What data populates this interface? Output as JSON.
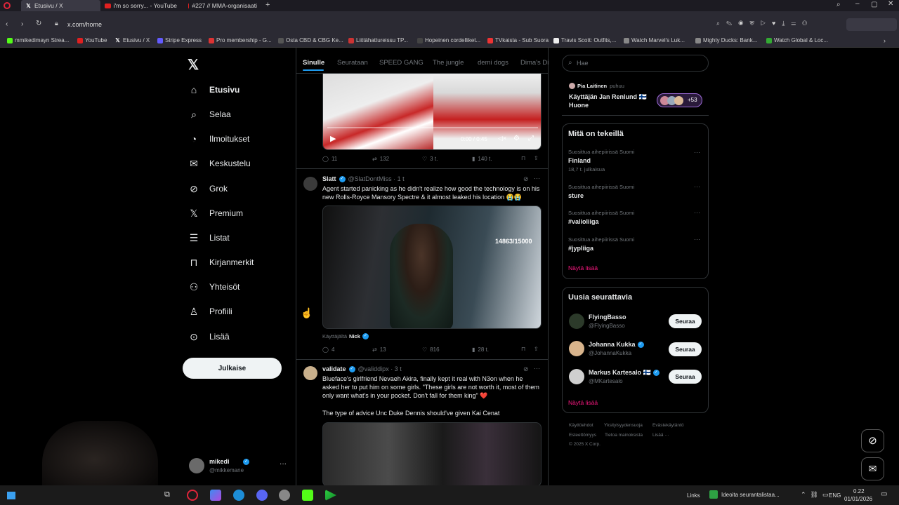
{
  "browser": {
    "tabs": [
      {
        "title": "Etusivu / X",
        "active": true
      },
      {
        "title": "i'm so sorry... - YouTube"
      },
      {
        "title": "#227 // MMA-organisaati"
      }
    ],
    "new_tab": "+",
    "url": "x.com/home",
    "bookmarks": [
      "mmikedimayn Strea...",
      "YouTube",
      "Etusivu / X",
      "Stripe Express",
      "Pro membership - G...",
      "Osta CBD & CBG Ke...",
      "Liittähattureissu TP...",
      "Hopeinen cordelliket...",
      "TVkaista - Sub Suora",
      "Travis Scott: Outfits,...",
      "Watch Marvel's Luk...",
      "Mighty Ducks: Bank...",
      "Watch Global & Loc..."
    ]
  },
  "nav": {
    "items": [
      {
        "label": "Etusivu",
        "icon": "home-icon"
      },
      {
        "label": "Selaa",
        "icon": "search-icon"
      },
      {
        "label": "Ilmoitukset",
        "icon": "bell-icon"
      },
      {
        "label": "Keskustelu",
        "icon": "mail-icon"
      },
      {
        "label": "Grok",
        "icon": "grok-icon"
      },
      {
        "label": "Premium",
        "icon": "x-icon"
      },
      {
        "label": "Listat",
        "icon": "list-icon"
      },
      {
        "label": "Kirjanmerkit",
        "icon": "bookmark-icon"
      },
      {
        "label": "Yhteisöt",
        "icon": "people-icon"
      },
      {
        "label": "Profiili",
        "icon": "person-icon"
      },
      {
        "label": "Lisää",
        "icon": "more-icon"
      }
    ],
    "post": "Julkaise",
    "account": {
      "name": "mikedi",
      "handle": "@mikkemane"
    }
  },
  "feed": {
    "tabs": [
      "Sinulle",
      "Seurataan",
      "SPEED GANG",
      "The jungle",
      "demi dogs",
      "Dima's Di"
    ],
    "post0": {
      "video_time": "0:00 / 0:45",
      "replies": "11",
      "reposts": "132",
      "likes": "3 t.",
      "views": "140 t."
    },
    "post1": {
      "name": "Slatt",
      "handle": "@SlatDontMiss · 1 t",
      "text": "Agent started panicking as he didn't realize how good the technology is on his new Rolls-Royce Mansory Spectre & it almost leaked his location 😭😭",
      "overlay": "14863/15000",
      "tagged_prefix": "Käyttäjältä",
      "tagged_name": "Nick",
      "replies": "4",
      "reposts": "13",
      "likes": "816",
      "views": "28 t."
    },
    "post2": {
      "name": "validate",
      "handle": "@validdipx · 3 t",
      "text": "Blueface's girlfriend Nevaeh Akira, finally kept it real with N3on when he asked her to put him on some girls. \"These girls are not worth it, most of them only want what's in your pocket. Don't fall for them king\" ❤️",
      "text2": "The type of advice Unc Duke Dennis should've given Kai Cenat"
    }
  },
  "sidebar": {
    "search_placeholder": "Hae",
    "space": {
      "host": "Pia Laitinen",
      "status": "puhuu",
      "title": "Käyttäjän Jan Renlund 🇫🇮 Huone",
      "count": "+53"
    },
    "trends_title": "Mitä on tekeillä",
    "trends": [
      {
        "ctx": "Suosittua aihepiirissä Suomi",
        "name": "Finland",
        "count": "18,7 t. julkaisua"
      },
      {
        "ctx": "Suosittua aihepiirissä Suomi",
        "name": "sture",
        "count": ""
      },
      {
        "ctx": "Suosittua aihepiirissä Suomi",
        "name": "#valioliiga",
        "count": ""
      },
      {
        "ctx": "Suosittua aihepiirissä Suomi",
        "name": "#jypliiga",
        "count": ""
      }
    ],
    "show_more": "Näytä lisää",
    "follow_title": "Uusia seurattavia",
    "follows": [
      {
        "name": "FlyingBasso",
        "handle": "@FlyingBasso"
      },
      {
        "name": "Johanna Kukka",
        "handle": "@JohannaKukka"
      },
      {
        "name": "Markus Kartesalo 🇫🇮",
        "handle": "@MKartesalo"
      }
    ],
    "follow_label": "Seuraa",
    "footer": [
      "Käyttöehdot",
      "Yksityisyydensuoja",
      "Evästekäytäntö",
      "Esteettömyys",
      "Tietoa mainoksista",
      "Lisää ···",
      "© 2025 X Corp."
    ]
  },
  "taskbar": {
    "links": "Links",
    "notification": "Ideoita seurantalistaa...",
    "lang": "ENG",
    "time": "0.22",
    "date": "01/01/2026"
  }
}
